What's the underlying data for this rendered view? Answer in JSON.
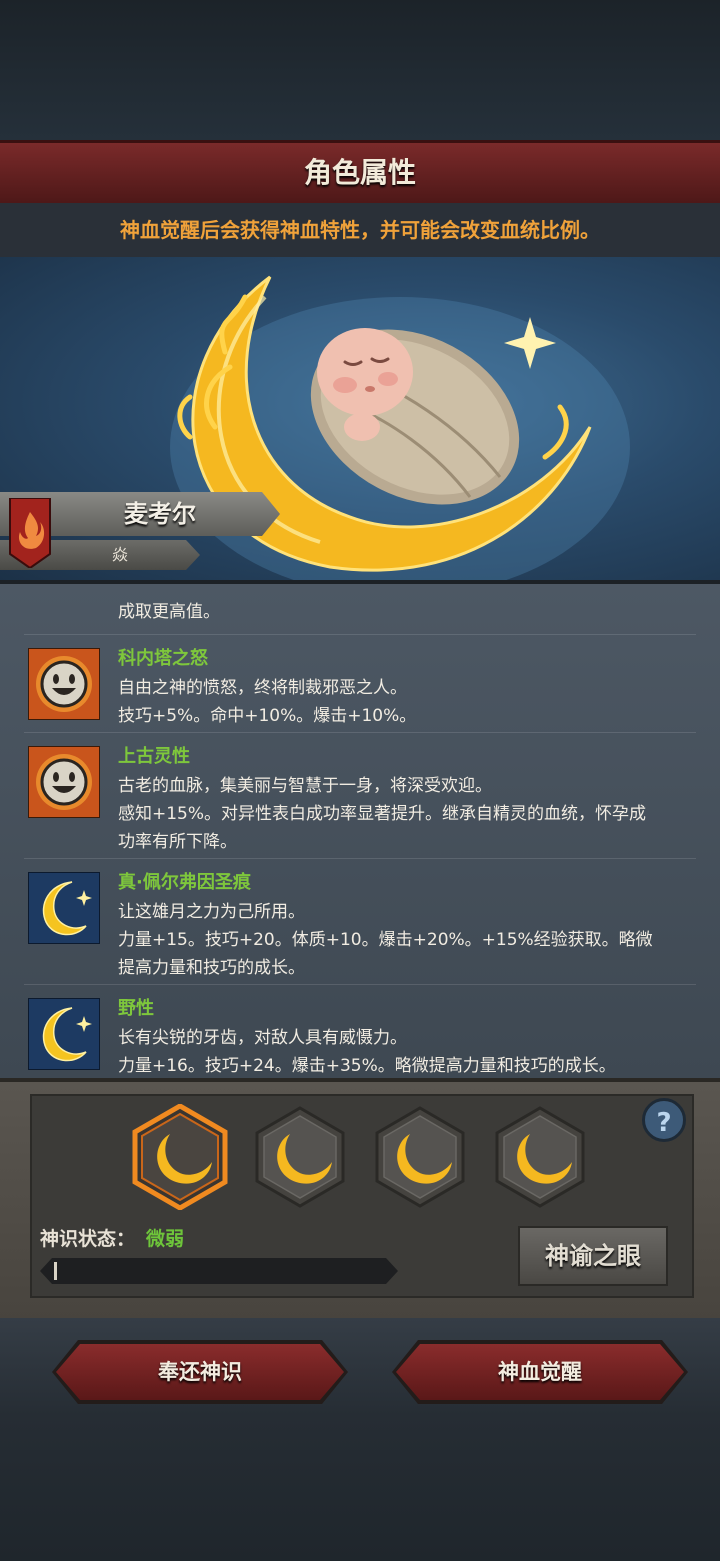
{
  "header": {
    "title": "角色属性"
  },
  "notice": "神血觉醒后会获得神血特性，并可能会改变血统比例。",
  "character": {
    "name": "麦考尔",
    "sub_label": "焱"
  },
  "traits_cut_line": "成取更高值。",
  "traits": [
    {
      "name": "科内塔之怒",
      "icon": "sun-face-icon",
      "lines": [
        "自由之神的愤怒，终将制裁邪恶之人。",
        "技巧+5%。命中+10%。爆击+10%。"
      ]
    },
    {
      "name": "上古灵性",
      "icon": "sun-face-icon",
      "lines": [
        "古老的血脉，集美丽与智慧于一身，将深受欢迎。",
        "感知+15%。对异性表白成功率显著提升。继承自精灵的血统，怀孕成",
        "功率有所下降。"
      ]
    },
    {
      "name": "真·佩尔弗因圣痕",
      "icon": "crescent-moon-icon",
      "lines": [
        "让这雄月之力为己所用。",
        "力量+15。技巧+20。体质+10。爆击+20%。+15%经验获取。略微",
        "提高力量和技巧的成长。"
      ]
    },
    {
      "name": "野性",
      "icon": "crescent-moon-icon",
      "lines": [
        "长有尖锐的牙齿，对敌人具有威慑力。",
        "力量+16。技巧+24。爆击+35%。略微提高力量和技巧的成长。"
      ]
    }
  ],
  "slots": [
    {
      "icon": "golden-crescent-icon",
      "selected": true
    },
    {
      "icon": "golden-crescent-icon",
      "selected": false
    },
    {
      "icon": "golden-crescent-icon",
      "selected": false
    },
    {
      "icon": "golden-crescent-icon",
      "selected": false
    }
  ],
  "divine_sense": {
    "label": "神识状态：",
    "value": "微弱",
    "progress": 0.01
  },
  "help": {
    "label": "?"
  },
  "oracle_eye_label": "神谕之眼",
  "actions": {
    "return_label": "奉还神识",
    "awaken_label": "神血觉醒"
  },
  "colors": {
    "accent_green": "#7ec73c",
    "notice_orange": "#f0a23a",
    "banner_red": "#7a2a2a",
    "gold": "#f5b820"
  }
}
